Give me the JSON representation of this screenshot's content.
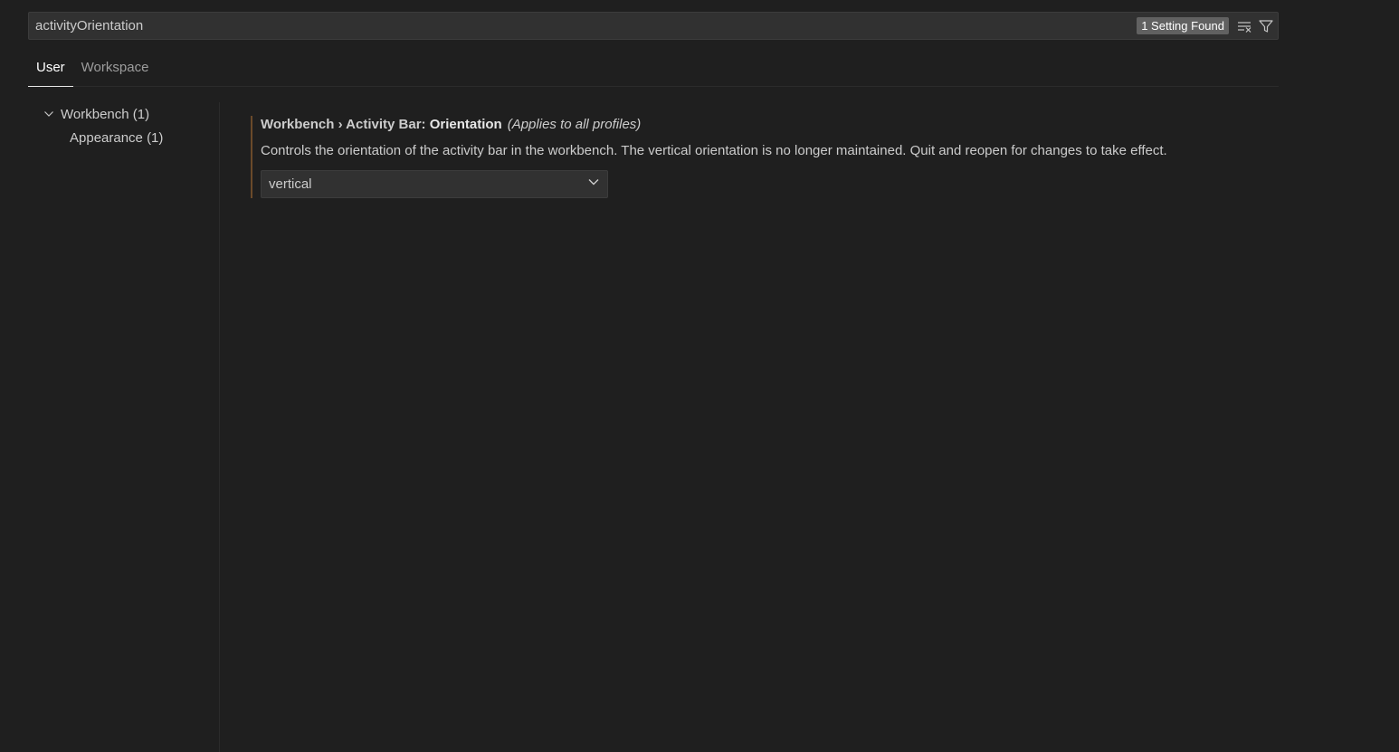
{
  "search": {
    "value": "activityOrientation",
    "result_badge": "1 Setting Found",
    "clear_icon": "clear-filter-icon",
    "filter_icon": "filter-icon"
  },
  "tabs": [
    {
      "label": "User",
      "active": true
    },
    {
      "label": "Workspace",
      "active": false
    }
  ],
  "toc": {
    "items": [
      {
        "label": "Workbench (1)",
        "expanded": true,
        "icon": "chevron-down-icon"
      },
      {
        "label": "Appearance (1)"
      }
    ]
  },
  "setting": {
    "category": "Workbench › Activity Bar: ",
    "key": "Orientation",
    "scope": "(Applies to all profiles)",
    "description": "Controls the orientation of the activity bar in the workbench. The vertical orientation is no longer maintained. Quit and reopen for changes to take effect.",
    "selected_value": "vertical",
    "dropdown_icon": "chevron-down-icon"
  },
  "colors": {
    "background": "#1f1f1f",
    "input_background": "#313131",
    "badge_background": "#616161",
    "modified_indicator": "#6b4a2a",
    "active_tab_underline": "#e7e7e7"
  }
}
